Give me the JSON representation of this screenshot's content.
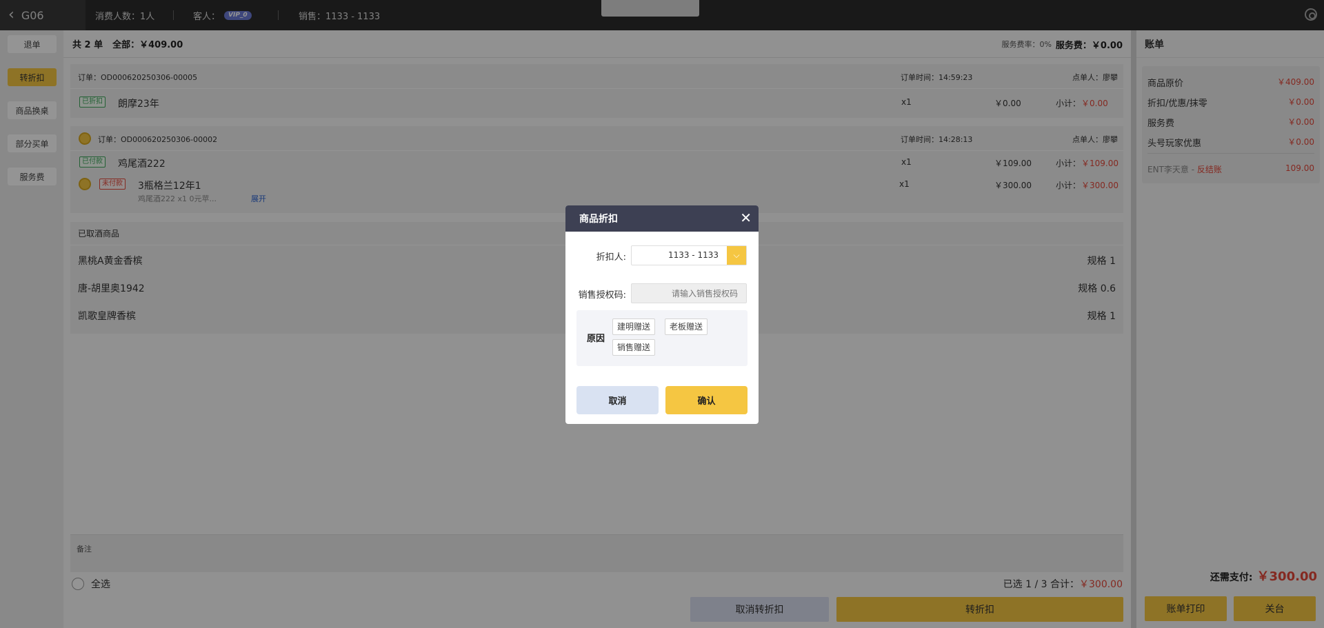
{
  "topbar": {
    "room": "G06",
    "guests_label": "消费人数：1人",
    "customer_label": "客人：",
    "vip_badge": "VIP_0",
    "sales_label": "销售：1133 - 1133"
  },
  "sidebar": {
    "items": [
      {
        "label": "退单",
        "active": false
      },
      {
        "label": "转折扣",
        "active": true
      },
      {
        "label": "商品换桌",
        "active": false
      },
      {
        "label": "部分买单",
        "active": false
      },
      {
        "label": "服务费",
        "active": false
      }
    ]
  },
  "summary": {
    "count": "共 2 单",
    "total": "全部：￥409.00",
    "service_rate_label": "服务费率：0%",
    "service_fee": "服务费：￥0.00"
  },
  "orders": [
    {
      "id": "订单：OD000620250306-00005",
      "time": "订单时间：14:59:23",
      "orderer": "点单人：廖攀",
      "items": [
        {
          "status": "已折扣",
          "name": "朗摩23年",
          "qty": "x1",
          "price": "￥0.00",
          "subtotal_label": "小计：",
          "subtotal": "￥0.00"
        }
      ]
    },
    {
      "id": "订单：OD000620250306-00002",
      "time": "订单时间：14:28:13",
      "orderer": "点单人：廖攀",
      "items": [
        {
          "status": "已付款",
          "name": "鸡尾酒222",
          "qty": "x1",
          "price": "￥109.00",
          "subtotal_label": "小计：",
          "subtotal": "￥109.00"
        },
        {
          "status": "未付款",
          "name": "3瓶格兰12年1",
          "sub": "鸡尾酒222 x1   0元苹...",
          "expand": "展开",
          "qty": "x1",
          "price": "￥300.00",
          "subtotal_label": "小计：",
          "subtotal": "￥300.00"
        }
      ]
    }
  ],
  "cancelled": {
    "title": "已取酒商品",
    "items": [
      {
        "name": "黑桃A黄金香槟",
        "spec": "规格 1"
      },
      {
        "name": "唐-胡里奥1942",
        "spec": "规格 0.6"
      },
      {
        "name": "凯歌皇牌香槟",
        "spec": "规格 1"
      }
    ]
  },
  "notes_label": "备注",
  "footer": {
    "select_all": "全选",
    "selected_info": "已选 1 / 3 合计：",
    "selected_total": "￥300.00",
    "cancel_discount": "取消转折扣",
    "discount": "转折扣"
  },
  "bill": {
    "title": "账单",
    "rows": [
      {
        "label": "商品原价",
        "value": "￥409.00"
      },
      {
        "label": "折扣/优惠/抹零",
        "value": "￥0.00"
      },
      {
        "label": "服务费",
        "value": "￥0.00"
      },
      {
        "label": "头号玩家优惠",
        "value": "￥0.00"
      }
    ],
    "ent_label": "ENT李天意 - ",
    "ent_tag": "反结账",
    "ent_value": "109.00",
    "due_label": "还需支付:",
    "due_value": "￥300.00",
    "print_button": "账单打印",
    "close_button": "关台"
  },
  "modal": {
    "title": "商品折扣",
    "discounter_label": "折扣人:",
    "discounter_value": "1133 - 1133",
    "auth_label": "销售授权码:",
    "auth_placeholder": "请输入销售授权码",
    "reason_label": "原因",
    "reasons": [
      "建明赠送",
      "老板赠送",
      "销售赠送"
    ],
    "cancel": "取消",
    "confirm": "确认"
  },
  "colors": {
    "accent": "#f5c642",
    "danger": "#e4483a",
    "modal_header": "#3d4053"
  }
}
